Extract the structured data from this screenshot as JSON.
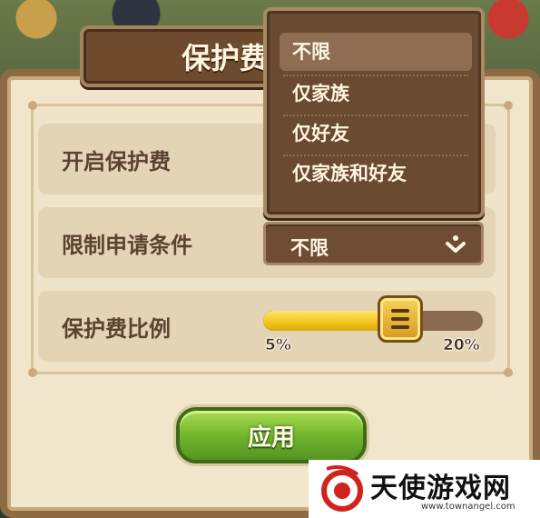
{
  "dialog": {
    "title": "保护费"
  },
  "rows": {
    "enable_label": "开启保护费",
    "restrict_label": "限制申请条件",
    "ratio_label": "保护费比例"
  },
  "restrict_select": {
    "selected": "不限",
    "options": [
      "不限",
      "仅家族",
      "仅好友",
      "仅家族和好友"
    ]
  },
  "ratio_slider": {
    "min_label": "5%",
    "max_label": "20%",
    "min": 5,
    "max": 20,
    "value_fraction": 0.6
  },
  "apply_button": {
    "label": "应用"
  },
  "watermark": {
    "name": "天使游戏网",
    "url": "www.townangel.com"
  },
  "colors": {
    "accent_green": "#6fb22a",
    "panel_brown": "#6e4d34",
    "slider_yellow": "#f3c51d"
  }
}
